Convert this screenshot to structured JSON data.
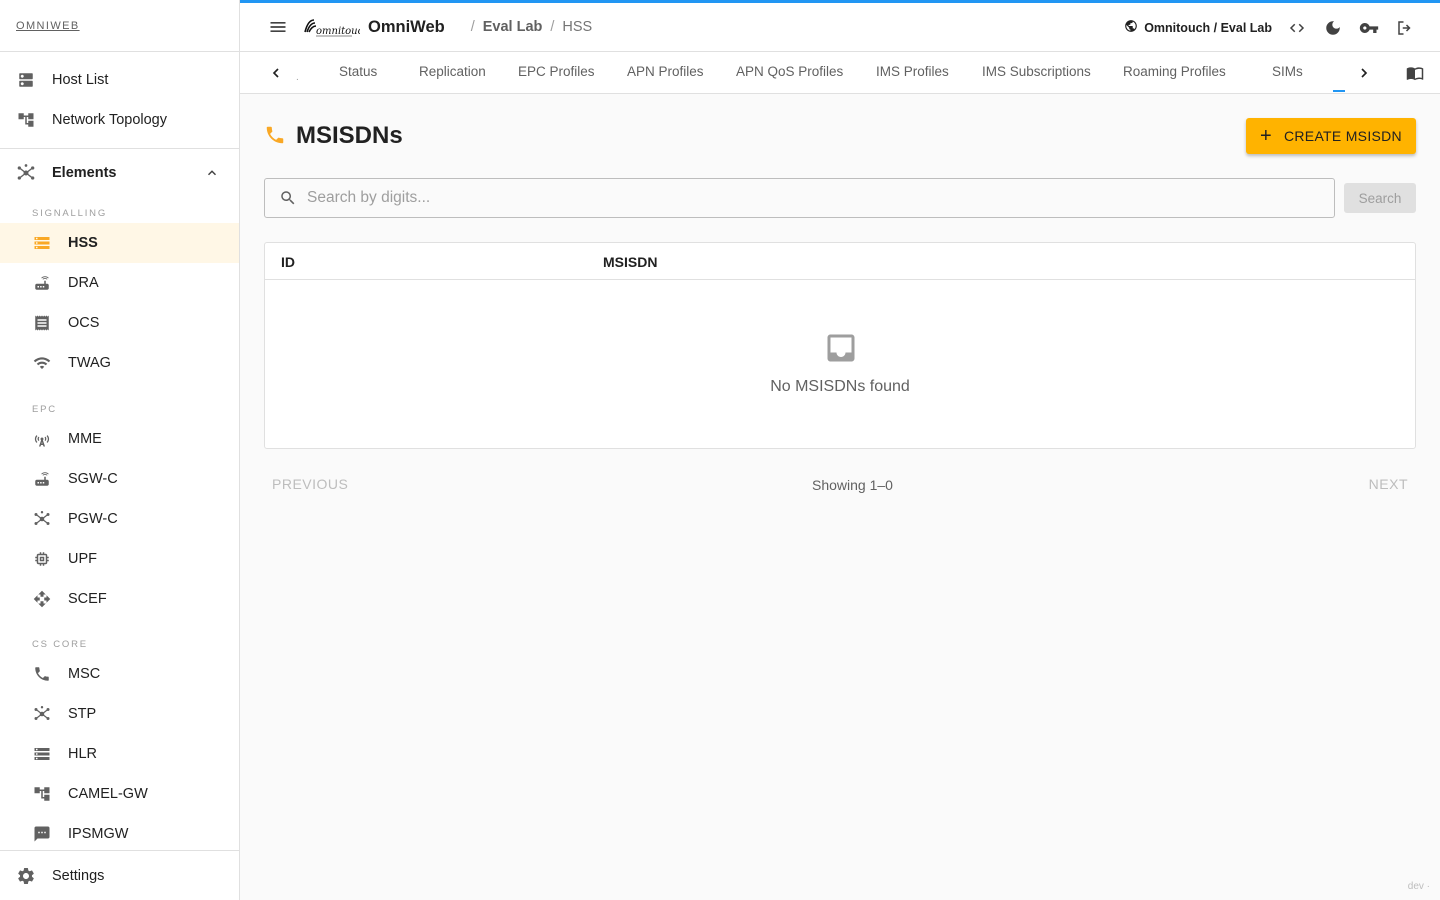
{
  "sidebar": {
    "brand": "OMNIWEB",
    "top_items": [
      {
        "label": "Host List",
        "icon": "dns-icon"
      },
      {
        "label": "Network Topology",
        "icon": "account-tree-icon"
      }
    ],
    "elements_label": "Elements",
    "sections": [
      {
        "label": "SIGNALLING",
        "items": [
          "HSS",
          "DRA",
          "OCS",
          "TWAG"
        ]
      },
      {
        "label": "EPC",
        "items": [
          "MME",
          "SGW-C",
          "PGW-C",
          "UPF",
          "SCEF"
        ]
      },
      {
        "label": "CS CORE",
        "items": [
          "MSC",
          "STP",
          "HLR",
          "CAMEL-GW",
          "IPSMGW"
        ]
      }
    ],
    "active_item": "HSS",
    "settings_label": "Settings"
  },
  "topbar": {
    "app_name": "OmniWeb",
    "logo_text": "omnitouch",
    "breadcrumb": [
      "Eval Lab",
      "HSS"
    ],
    "tenant": "Omnitouch / Eval Lab"
  },
  "tabs": {
    "items": [
      "Status",
      "Replication",
      "EPC Profiles",
      "APN Profiles",
      "APN QoS Profiles",
      "IMS Profiles",
      "IMS Subscriptions",
      "Roaming Profiles",
      "SIMs"
    ]
  },
  "page": {
    "title": "MSISDNs",
    "create_button": "CREATE MSISDN",
    "search_placeholder": "Search by digits...",
    "search_button": "Search",
    "columns": [
      "ID",
      "MSISDN"
    ],
    "empty_text": "No MSISDNs found",
    "previous": "PREVIOUS",
    "showing": "Showing 1–0",
    "next": "NEXT"
  },
  "env_label": "dev ·",
  "colors": {
    "accent": "#ffb300",
    "top_border": "#2196f3",
    "active_bg": "#fff7e6"
  }
}
